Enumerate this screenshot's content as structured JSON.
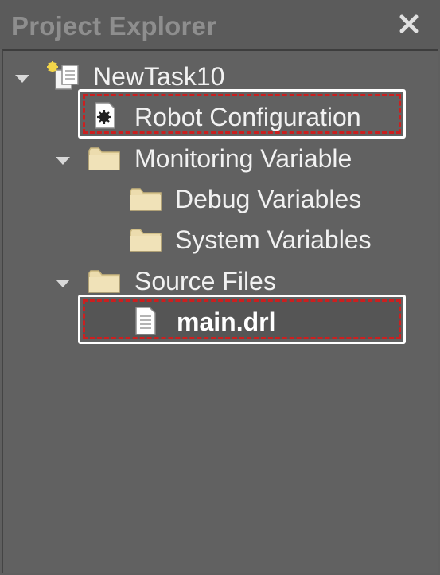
{
  "panel": {
    "title": "Project Explorer",
    "close_icon": "close-icon"
  },
  "tree": {
    "root": {
      "label": "NewTask10",
      "icon": "project-icon",
      "expanded": true
    },
    "robot_config": {
      "label": "Robot Configuration",
      "icon": "config-file-icon",
      "highlighted": true
    },
    "monitoring": {
      "label": "Monitoring Variable",
      "icon": "folder-icon",
      "expanded": true
    },
    "debug_vars": {
      "label": "Debug Variables",
      "icon": "folder-icon"
    },
    "system_vars": {
      "label": "System Variables",
      "icon": "folder-icon"
    },
    "source_files": {
      "label": "Source Files",
      "icon": "folder-icon",
      "expanded": true
    },
    "main_drl": {
      "label": "main.drl",
      "icon": "document-icon",
      "highlighted": true
    }
  },
  "colors": {
    "background": "#5f5f5f",
    "highlight_dash": "#cc1f1f",
    "folder": "#ecdcae"
  }
}
